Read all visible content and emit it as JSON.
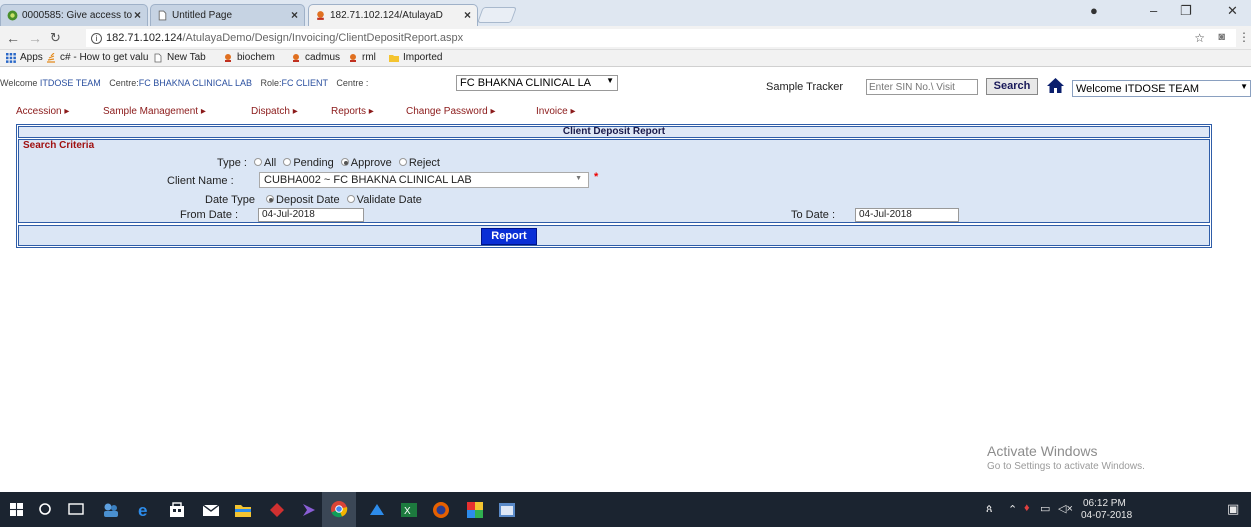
{
  "browser": {
    "tabs": [
      {
        "label": "0000585: Give access to"
      },
      {
        "label": "Untitled Page"
      },
      {
        "label": "182.71.102.124/AtulayaD"
      }
    ],
    "url_host": "182.71.102.124",
    "url_path": "/AtulayaDemo/Design/Invoicing/ClientDepositReport.aspx",
    "bookmarks": [
      "Apps",
      "c# - How to get valu",
      "New Tab",
      "biochem",
      "cadmus",
      "rml",
      "Imported"
    ]
  },
  "header": {
    "welcome_label": "Welcome",
    "welcome_user": "ITDOSE TEAM",
    "centre_label": "Centre:",
    "centre_value": "FC BHAKNA CLINICAL LAB",
    "role_label": "Role:",
    "role_value": "FC CLIENT",
    "centre2_label": "Centre :",
    "centre_select": "FC BHAKNA CLINICAL LA",
    "sample_tracker_label": "Sample Tracker",
    "sin_placeholder": "Enter SIN No.\\ Visit",
    "search_label": "Search",
    "user_select": "Welcome ITDOSE TEAM"
  },
  "menu": [
    "Accession",
    "Sample Management",
    "Dispatch",
    "Reports",
    "Change Password",
    "Invoice"
  ],
  "report": {
    "title": "Client Deposit Report",
    "criteria_title": "Search Criteria",
    "type_label": "Type :",
    "type_options": [
      "All",
      "Pending",
      "Approve",
      "Reject"
    ],
    "type_selected": "Approve",
    "client_label": "Client Name :",
    "client_value": "CUBHA002 ~ FC BHAKNA CLINICAL LAB",
    "required_mark": "*",
    "date_type_label": "Date Type",
    "date_type_options": [
      "Deposit Date",
      "Validate Date"
    ],
    "date_type_selected": "Deposit Date",
    "from_label": "From Date :",
    "from_value": "04-Jul-2018",
    "to_label": "To Date :",
    "to_value": "04-Jul-2018",
    "button_label": "Report"
  },
  "watermark": {
    "title": "Activate Windows",
    "subtitle": "Go to Settings to activate Windows."
  },
  "taskbar": {
    "time": "06:12 PM",
    "date": "04-07-2018"
  },
  "colors": {
    "panel_border": "#2f5da8",
    "criteria_bg": "#dbe6f5",
    "button_bg": "#0a2fd6",
    "menu_text": "#8b1a1a"
  }
}
